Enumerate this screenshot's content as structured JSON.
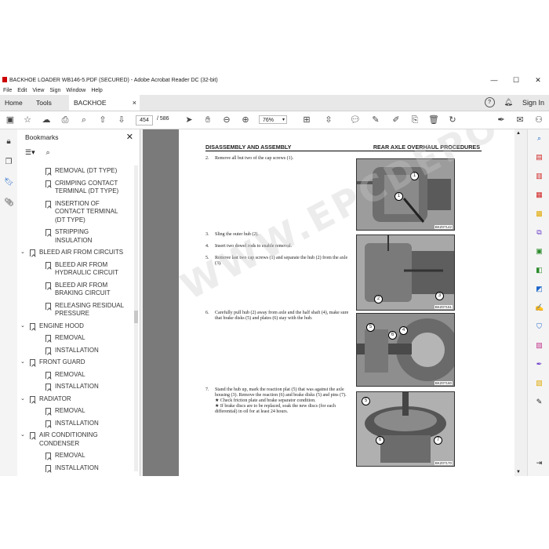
{
  "window": {
    "title": "BACKHOE LOADER WB146-5.PDF (SECURED) - Adobe Acrobat Reader DC (32-bit)",
    "minimize": "—",
    "maximize": "☐",
    "close": "✕"
  },
  "menu": [
    "File",
    "Edit",
    "View",
    "Sign",
    "Window",
    "Help"
  ],
  "tabs": {
    "home": "Home",
    "tools": "Tools",
    "doc": "BACKHOE LOADER...",
    "doc_close": "×",
    "sign_in": "Sign In",
    "help": "?"
  },
  "toolbar": {
    "page_current": "454",
    "page_total": "/ 586",
    "zoom": "76%"
  },
  "bookmarks": {
    "title": "Bookmarks",
    "close": "✕",
    "items": [
      {
        "label": "REMOVAL (DT TYPE)",
        "level": 2
      },
      {
        "label": "CRIMPING CONTACT TERMINAL (DT TYPE)",
        "level": 2
      },
      {
        "label": "INSERTION OF CONTACT TERMINAL (DT TYPE)",
        "level": 2
      },
      {
        "label": "STRIPPING INSULATION",
        "level": 2
      },
      {
        "label": "BLEED AIR FROM CIRCUITS",
        "level": 1
      },
      {
        "label": "BLEED AIR FROM HYDRAULIC CIRCUIT",
        "level": 2
      },
      {
        "label": "BLEED AIR FROM BRAKING CIRCUIT",
        "level": 2
      },
      {
        "label": "RELEASING RESIDUAL PRESSURE",
        "level": 2
      },
      {
        "label": "ENGINE HOOD",
        "level": 1
      },
      {
        "label": "REMOVAL",
        "level": 2
      },
      {
        "label": "INSTALLATION",
        "level": 2
      },
      {
        "label": "FRONT GUARD",
        "level": 1
      },
      {
        "label": "REMOVAL",
        "level": 2
      },
      {
        "label": "INSTALLATION",
        "level": 2
      },
      {
        "label": "RADIATOR",
        "level": 1
      },
      {
        "label": "REMOVAL",
        "level": 2
      },
      {
        "label": "INSTALLATION",
        "level": 2
      },
      {
        "label": "AIR CONDITIONING CONDENSER",
        "level": 1
      },
      {
        "label": "REMOVAL",
        "level": 2
      },
      {
        "label": "INSTALLATION",
        "level": 2
      }
    ]
  },
  "page": {
    "header_left": "DISASSEMBLY AND ASSEMBLY",
    "header_right": "REAR AXLE OVERHAUL PROCEDURES",
    "watermark": "WWW.EPCDEPOT.COM",
    "steps": [
      {
        "n": "2.",
        "text": "Remove all but two of the cap screws (1)."
      },
      {
        "n": "3.",
        "text": "Sling the outer hub (2)."
      },
      {
        "n": "4.",
        "text": "Insert two dowel rods to enable removal."
      },
      {
        "n": "5.",
        "text": "Remove last two cap screws (1) and separate the hub (2) from the axle (3)."
      },
      {
        "n": "6.",
        "text": "Carefully pull hub (2) away from axle and the half shaft (4), make sure that brake disks (5) and plates (6) stay with the hub."
      },
      {
        "n": "7.",
        "text": "Stand the hub up, mark the reaction plat (5) that was against the axle housing (3). Remove the reaction (6) and brake disks (5) and pins (7)."
      }
    ],
    "bullets": [
      "★  Check friction plate and brake separator condition.",
      "★  If brake discs are to be replaced, soak the new discs (for each differential) in oil for at least 24 hours."
    ],
    "figures": [
      {
        "caption": "BKZ07142",
        "callouts": [
          "1",
          "1"
        ]
      },
      {
        "caption": "BKZ07151",
        "callouts": [
          "2",
          "3"
        ]
      },
      {
        "caption": "BKZ07160",
        "callouts": [
          "5",
          "6",
          "4"
        ]
      },
      {
        "caption": "BKZ07170",
        "callouts": [
          "5",
          "6",
          "7"
        ]
      }
    ]
  }
}
